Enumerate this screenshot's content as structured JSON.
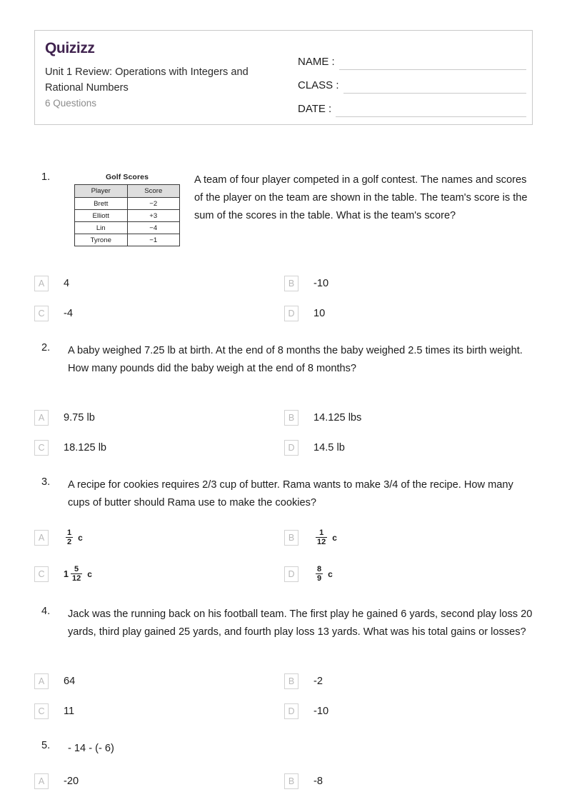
{
  "header": {
    "logo": "Quizizz",
    "title": "Unit 1 Review: Operations with Integers and Rational Numbers",
    "question_count": "6 Questions",
    "fields": [
      {
        "label": "NAME :",
        "value": ""
      },
      {
        "label": "CLASS :",
        "value": ""
      },
      {
        "label": "DATE  :",
        "value": ""
      }
    ]
  },
  "questions": [
    {
      "number": "1.",
      "text": "A team of four player competed in a golf contest. The names and scores of the player on the team are shown in the table. The team's score is the sum of the scores in the table. What is the team's score?",
      "table": {
        "caption": "Golf Scores",
        "columns": [
          "Player",
          "Score"
        ],
        "rows": [
          [
            "Brett",
            "−2"
          ],
          [
            "Elliott",
            "+3"
          ],
          [
            "Lin",
            "−4"
          ],
          [
            "Tyrone",
            "−1"
          ]
        ]
      },
      "options": [
        {
          "letter": "A",
          "text": "4"
        },
        {
          "letter": "B",
          "text": "-10"
        },
        {
          "letter": "C",
          "text": "-4"
        },
        {
          "letter": "D",
          "text": "10"
        }
      ]
    },
    {
      "number": "2.",
      "text": "A baby weighed 7.25 lb at birth. At the end of 8 months the baby weighed 2.5 times its birth weight. How many pounds did the baby weigh at the end of 8 months?",
      "options": [
        {
          "letter": "A",
          "text": "9.75 lb"
        },
        {
          "letter": "B",
          "text": "14.125 lbs"
        },
        {
          "letter": "C",
          "text": "18.125 lb"
        },
        {
          "letter": "D",
          "text": "14.5 lb"
        }
      ]
    },
    {
      "number": "3.",
      "text": "A recipe for cookies requires 2/3 cup of butter. Rama wants to make 3/4 of the recipe. How many cups of butter should Rama use to make the cookies?",
      "options": [
        {
          "letter": "A",
          "whole": "",
          "numerator": "1",
          "denominator": "2",
          "unit": "c"
        },
        {
          "letter": "B",
          "whole": "",
          "numerator": "1",
          "denominator": "12",
          "unit": "c"
        },
        {
          "letter": "C",
          "whole": "1",
          "numerator": "5",
          "denominator": "12",
          "unit": "c"
        },
        {
          "letter": "D",
          "whole": "",
          "numerator": "8",
          "denominator": "9",
          "unit": "c"
        }
      ]
    },
    {
      "number": "4.",
      "text": "Jack was the running back on his football team. The first play he gained 6 yards, second play loss 20 yards, third play gained 25 yards, and fourth play loss 13 yards. What was his total gains or losses?",
      "options": [
        {
          "letter": "A",
          "text": "64"
        },
        {
          "letter": "B",
          "text": "-2"
        },
        {
          "letter": "C",
          "text": "11"
        },
        {
          "letter": "D",
          "text": "-10"
        }
      ]
    },
    {
      "number": "5.",
      "text": "- 14 - (- 6)",
      "options": [
        {
          "letter": "A",
          "text": "-20"
        },
        {
          "letter": "B",
          "text": "-8"
        }
      ]
    }
  ]
}
